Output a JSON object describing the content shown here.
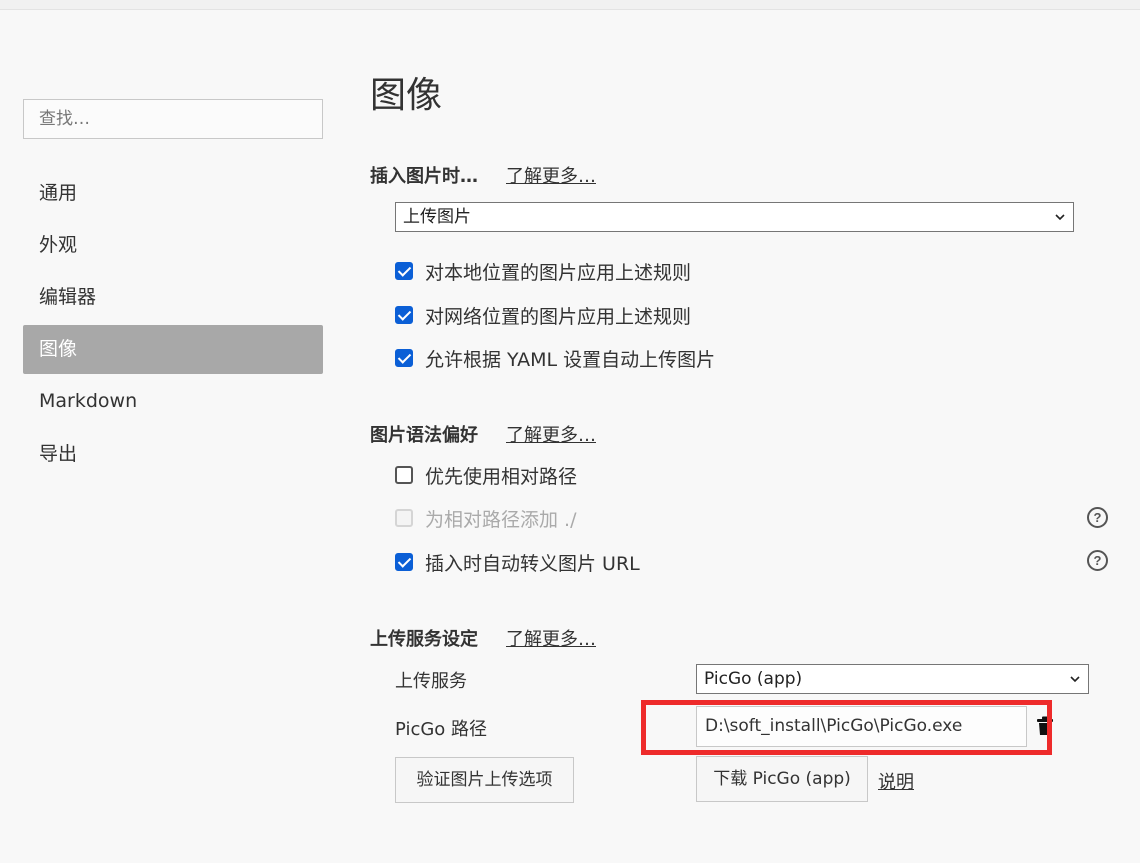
{
  "sidebar": {
    "search_placeholder": "查找…",
    "items": [
      {
        "label": "通用"
      },
      {
        "label": "外观"
      },
      {
        "label": "编辑器"
      },
      {
        "label": "图像",
        "active": true
      },
      {
        "label": "Markdown"
      },
      {
        "label": "导出"
      }
    ]
  },
  "main": {
    "title": "图像",
    "insert": {
      "heading": "插入图片时…",
      "learn_more": "了解更多…",
      "select_value": "上传图片",
      "options": [
        {
          "label": "对本地位置的图片应用上述规则",
          "checked": true
        },
        {
          "label": "对网络位置的图片应用上述规则",
          "checked": true
        },
        {
          "label": "允许根据 YAML 设置自动上传图片",
          "checked": true
        }
      ]
    },
    "syntax": {
      "heading": "图片语法偏好",
      "learn_more": "了解更多…",
      "options": [
        {
          "label": "优先使用相对路径",
          "checked": false
        },
        {
          "label": "为相对路径添加 ./",
          "checked": false,
          "disabled": true
        },
        {
          "label": "插入时自动转义图片 URL",
          "checked": true
        }
      ],
      "help_glyph": "?"
    },
    "upload": {
      "heading": "上传服务设定",
      "learn_more": "了解更多…",
      "service_label": "上传服务",
      "service_value": "PicGo (app)",
      "path_label": "PicGo 路径",
      "path_value": "D:\\soft_install\\PicGo\\PicGo.exe",
      "verify_button": "验证图片上传选项",
      "download_button": "下载 PicGo (app)",
      "explain_link": "说明"
    }
  },
  "colors": {
    "checkbox_accent": "#0b5fd6",
    "active_sidebar": "#a8a8a8",
    "highlight_box": "#ee2b2b"
  }
}
